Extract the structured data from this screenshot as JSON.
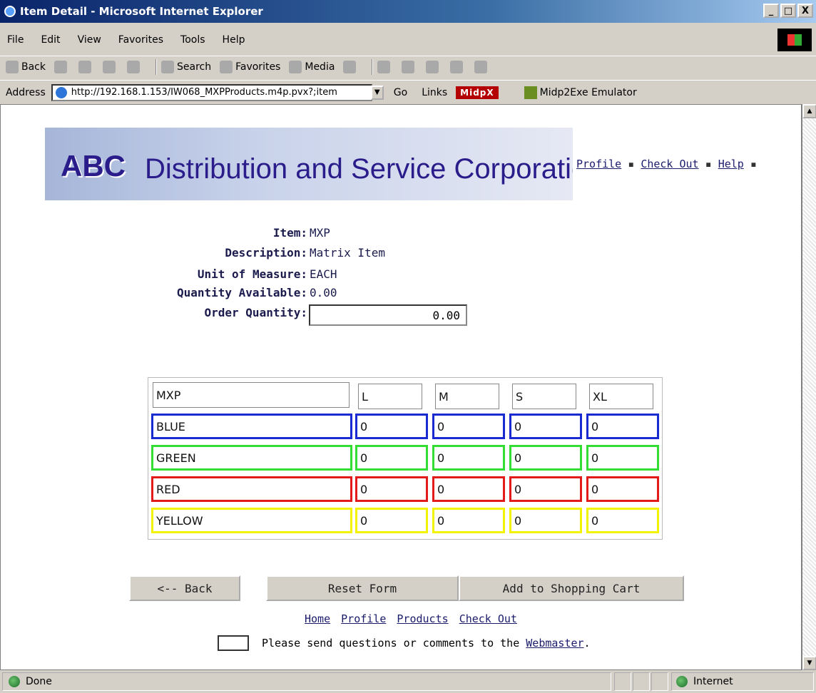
{
  "window": {
    "title": "Item Detail - Microsoft Internet Explorer",
    "buttons": [
      "_",
      "□",
      "X"
    ]
  },
  "menu": [
    "File",
    "Edit",
    "View",
    "Favorites",
    "Tools",
    "Help"
  ],
  "toolbar": {
    "back": "Back",
    "search": "Search",
    "favorites": "Favorites",
    "media": "Media"
  },
  "address": {
    "label": "Address",
    "url": "http://192.168.1.153/IW068_MXPProducts.m4p.pvx?;item",
    "go": "Go",
    "links": "Links",
    "midpx": "MidpX",
    "emulator": "Midp2Exe Emulator"
  },
  "banner": {
    "abc": "ABC",
    "rest": "Distribution and Service Corporation"
  },
  "topnav": {
    "profile": "Profile",
    "checkout": "Check Out",
    "help": "Help"
  },
  "item": {
    "item_label": "Item:",
    "item_value": "MXP",
    "desc_label": "Description:",
    "desc_value": "Matrix Item",
    "uom_label": "Unit of Measure:",
    "uom_value": "EACH",
    "qty_label": "Quantity Available:",
    "qty_value": "0.00",
    "order_label": "Order Quantity:",
    "order_value": "0.00"
  },
  "matrix": {
    "header": [
      "MXP",
      "L",
      "M",
      "S",
      "XL"
    ],
    "rows": [
      {
        "color": "BLUE",
        "border": "#1a2ad1",
        "values": [
          "0",
          "0",
          "0",
          "0"
        ]
      },
      {
        "color": "GREEN",
        "border": "#33dd33",
        "values": [
          "0",
          "0",
          "0",
          "0"
        ]
      },
      {
        "color": "RED",
        "border": "#e21a1a",
        "values": [
          "0",
          "0",
          "0",
          "0"
        ]
      },
      {
        "color": "YELLOW",
        "border": "#f3f300",
        "values": [
          "0",
          "0",
          "0",
          "0"
        ]
      }
    ]
  },
  "buttons": {
    "back": "<-- Back",
    "reset": "Reset Form",
    "add": "Add to Shopping Cart"
  },
  "footer": {
    "links": [
      "Home",
      "Profile",
      "Products",
      "Check Out"
    ],
    "note": "Please send questions or comments to the",
    "webmaster": "Webmaster",
    "period": "."
  },
  "status": {
    "left": "Done",
    "zone": "Internet"
  }
}
